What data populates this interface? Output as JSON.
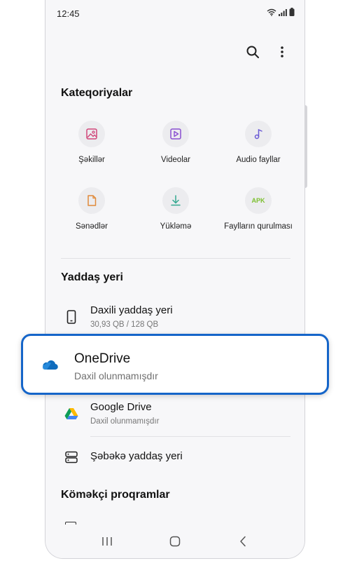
{
  "status_bar": {
    "time": "12:45"
  },
  "categories": {
    "title": "Kateqoriyalar",
    "items": [
      {
        "label": "Şəkillər",
        "icon": "image-icon",
        "color": "#d1477a"
      },
      {
        "label": "Videolar",
        "icon": "video-icon",
        "color": "#8a4fd1"
      },
      {
        "label": "Audio fayllar",
        "icon": "music-icon",
        "color": "#6b5bd6"
      },
      {
        "label": "Sənədlər",
        "icon": "document-icon",
        "color": "#e08a3a"
      },
      {
        "label": "Yükləmə",
        "icon": "download-icon",
        "color": "#33a890"
      },
      {
        "label": "Faylların qurulması",
        "icon": "apk-icon",
        "icon_text": "APK",
        "color": "#7cbf2f"
      }
    ]
  },
  "storage": {
    "title": "Yaddaş yeri",
    "internal": {
      "title": "Daxili yaddaş yeri",
      "sub": "30,93 QB / 128 QB"
    },
    "onedrive": {
      "title": "OneDrive",
      "sub": "Daxil olunmamışdır"
    },
    "google_drive": {
      "title": "Google Drive",
      "sub": "Daxil olunmamışdır"
    },
    "network": {
      "title": "Şəbəkə yaddaş yeri"
    }
  },
  "utilities": {
    "title": "Köməkçi proqramlar"
  },
  "colors": {
    "accent": "#1565c9",
    "onedrive": "#0f6cbd"
  }
}
